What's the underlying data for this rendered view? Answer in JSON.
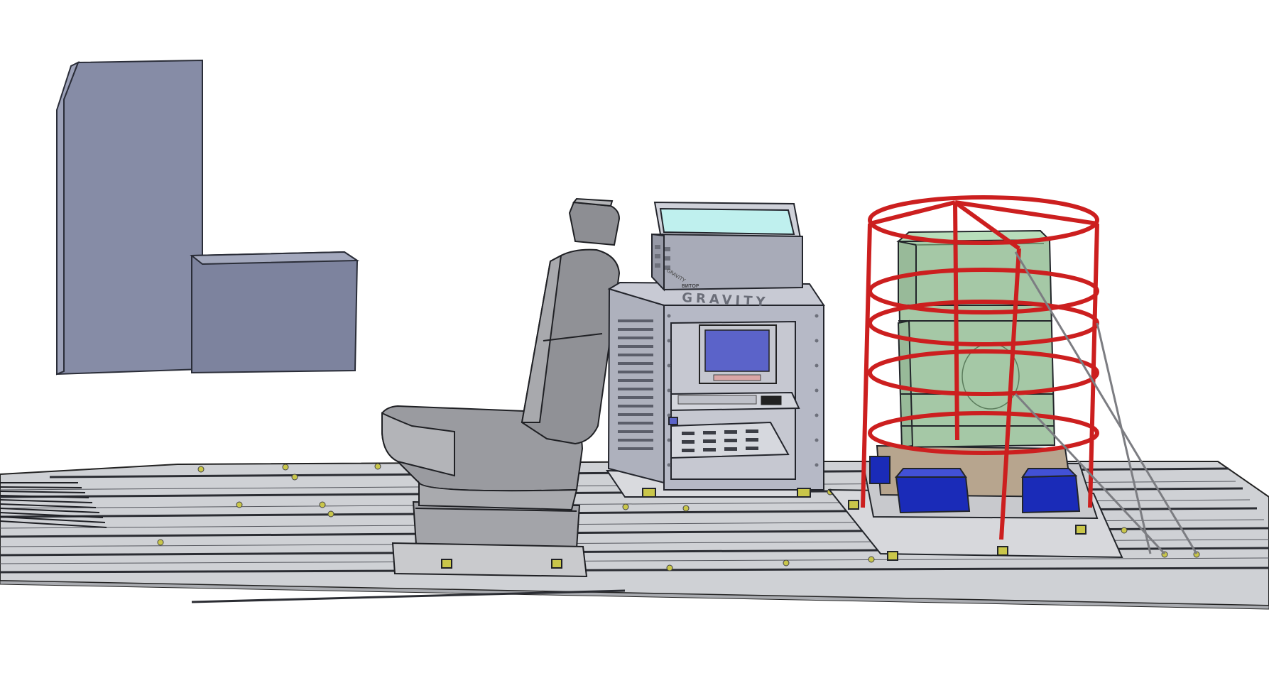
{
  "cabinet": {
    "logo_text": "GRAVITY",
    "panel_label": "ВИТОР",
    "side_text": "GRAVITY"
  },
  "colors": {
    "block": "#8a90a8",
    "block_dark": "#6f7590",
    "floor": "#d0d2d6",
    "floor_line": "#2b2d33",
    "seat": "#9e9fa4",
    "seat_dark": "#7d7e84",
    "cabinet": "#b9bcc8",
    "screen": "#5b63c9",
    "tank": "#a7c9a8",
    "tank_top": "#b6dcb8",
    "cage": "#d21f1f",
    "motor": "#1a2bb8",
    "box_glass": "#bff0ee"
  }
}
